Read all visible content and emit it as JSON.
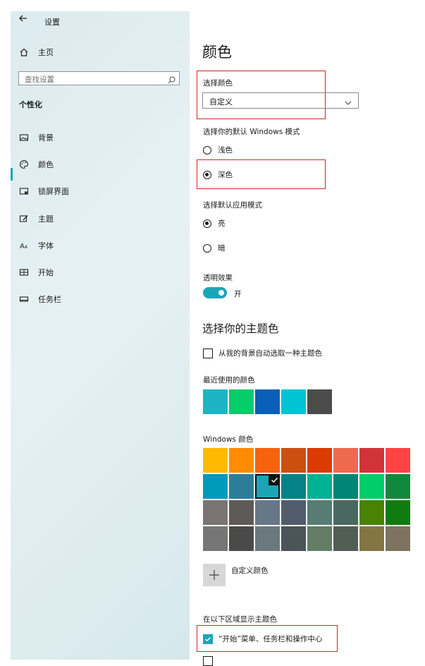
{
  "window": {
    "title": "设置"
  },
  "sidebar": {
    "home_label": "主页",
    "search_placeholder": "查找设置",
    "section_label": "个性化",
    "items": [
      {
        "label": "背景",
        "icon": "picture-icon"
      },
      {
        "label": "颜色",
        "icon": "palette-icon",
        "active": true
      },
      {
        "label": "锁屏界面",
        "icon": "lock-screen-icon"
      },
      {
        "label": "主题",
        "icon": "theme-brush-icon"
      },
      {
        "label": "字体",
        "icon": "font-icon"
      },
      {
        "label": "开始",
        "icon": "start-grid-icon"
      },
      {
        "label": "任务栏",
        "icon": "taskbar-icon"
      }
    ]
  },
  "main": {
    "title": "颜色",
    "choose_color": {
      "label": "选择颜色",
      "value": "自定义"
    },
    "windows_mode": {
      "label": "选择你的默认 Windows 模式",
      "options": [
        "浅色",
        "深色"
      ],
      "selected": "深色"
    },
    "app_mode": {
      "label": "选择默认应用模式",
      "options": [
        "亮",
        "暗"
      ],
      "selected": "亮"
    },
    "transparency": {
      "label": "透明效果",
      "state": "开"
    },
    "accent_heading": "选择你的主题色",
    "auto_accent_label": "从我的背景自动选取一种主题色",
    "recent_label": "最近使用的颜色",
    "recent_colors": [
      "#1cb4c4",
      "#06cc6a",
      "#0a5fb8",
      "#00c4d6",
      "#4b4b4b"
    ],
    "windows_colors_label": "Windows 颜色",
    "windows_colors": [
      [
        "#ffb900",
        "#ff8c00",
        "#f7630c",
        "#ca5010",
        "#da3b01",
        "#ef6950",
        "#d13438",
        "#ff4343"
      ],
      [
        "#0099bc",
        "#2d7d9a",
        "#1aa6b7",
        "#038387",
        "#00b294",
        "#018574",
        "#00cc6a",
        "#10893e"
      ],
      [
        "#7a7574",
        "#5d5a58",
        "#68768a",
        "#515c6b",
        "#567c73",
        "#486860",
        "#498205",
        "#107c10"
      ],
      [
        "#767676",
        "#4c4a48",
        "#69797e",
        "#4a5459",
        "#647c64",
        "#525e54",
        "#847545",
        "#7e735f"
      ]
    ],
    "selected_swatch": "#1aa6b7",
    "custom_color_label": "自定义颜色",
    "show_accent_label": "在以下区域显示主题色",
    "show_accent_option": "“开始”菜单、任务栏和操作中心",
    "accent_color": "#1aa6b7",
    "highlight_color": "#d8222a"
  }
}
